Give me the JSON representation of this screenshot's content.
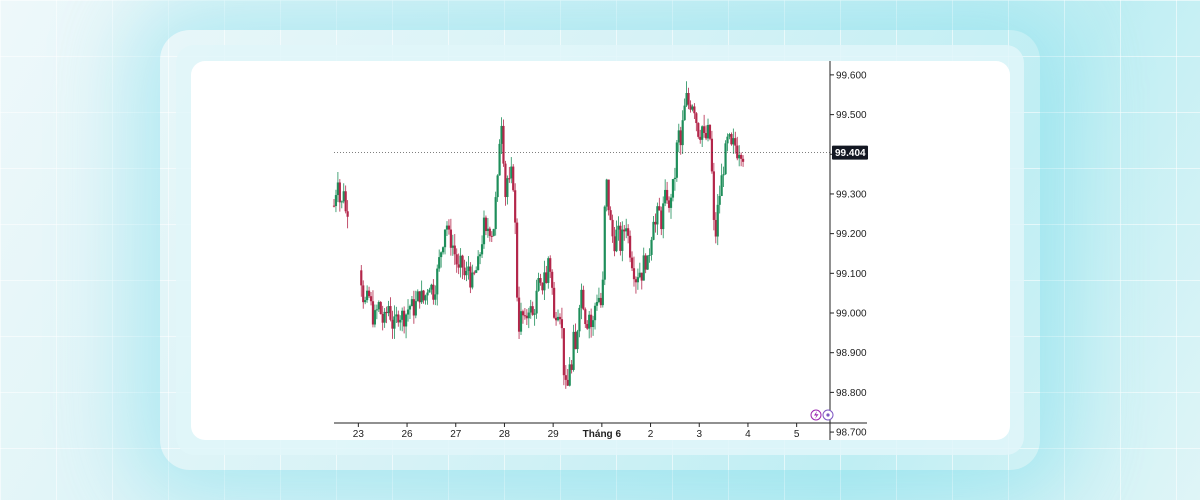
{
  "chart_data": {
    "type": "candlestick",
    "y_ticks": [
      "99.600",
      "99.500",
      "99.400",
      "99.300",
      "99.200",
      "99.100",
      "99.000",
      "98.900",
      "98.800",
      "98.700"
    ],
    "y_tick_values": [
      99.6,
      99.5,
      99.4,
      99.3,
      99.2,
      99.1,
      99.0,
      98.9,
      98.8,
      98.7
    ],
    "ylim": [
      98.68,
      99.635
    ],
    "last_price": 99.404,
    "last_price_label": "99.404",
    "x_tick_labels": [
      {
        "label": "23",
        "pos": 0.5,
        "bold": false
      },
      {
        "label": "26",
        "pos": 1.5,
        "bold": false
      },
      {
        "label": "27",
        "pos": 2.5,
        "bold": false
      },
      {
        "label": "28",
        "pos": 3.5,
        "bold": false
      },
      {
        "label": "29",
        "pos": 4.5,
        "bold": false
      },
      {
        "label": "Tháng 6",
        "pos": 5.5,
        "bold": true
      },
      {
        "label": "2",
        "pos": 6.5,
        "bold": false
      },
      {
        "label": "3",
        "pos": 7.5,
        "bold": false
      },
      {
        "label": "4",
        "pos": 8.5,
        "bold": false
      },
      {
        "label": "5",
        "pos": 9.5,
        "bold": false
      }
    ],
    "x_range": [
      0,
      10
    ],
    "price_path": [
      [
        0.0,
        99.27
      ],
      [
        0.08,
        99.35
      ],
      [
        0.14,
        99.25
      ],
      [
        0.2,
        99.32
      ],
      [
        0.26,
        99.22
      ],
      [
        0.3,
        99.31
      ],
      [
        0.55,
        99.1
      ],
      [
        0.62,
        99.02
      ],
      [
        0.72,
        99.04
      ],
      [
        0.82,
        98.98
      ],
      [
        0.92,
        99.02
      ],
      [
        1.02,
        98.97
      ],
      [
        1.12,
        99.02
      ],
      [
        1.22,
        98.96
      ],
      [
        1.32,
        99.0
      ],
      [
        1.45,
        98.99
      ],
      [
        1.55,
        99.02
      ],
      [
        1.65,
        99.01
      ],
      [
        1.75,
        99.05
      ],
      [
        1.85,
        99.03
      ],
      [
        1.95,
        99.08
      ],
      [
        2.05,
        99.05
      ],
      [
        2.12,
        99.1
      ],
      [
        2.2,
        99.16
      ],
      [
        2.26,
        99.2
      ],
      [
        2.3,
        99.24
      ],
      [
        2.36,
        99.19
      ],
      [
        2.42,
        99.18
      ],
      [
        2.5,
        99.14
      ],
      [
        2.56,
        99.1
      ],
      [
        2.62,
        99.13
      ],
      [
        2.7,
        99.08
      ],
      [
        2.76,
        99.12
      ],
      [
        2.82,
        99.07
      ],
      [
        2.9,
        99.1
      ],
      [
        2.96,
        99.12
      ],
      [
        3.02,
        99.17
      ],
      [
        3.08,
        99.22
      ],
      [
        3.12,
        99.19
      ],
      [
        3.18,
        99.23
      ],
      [
        3.22,
        99.2
      ],
      [
        3.28,
        99.22
      ],
      [
        3.32,
        99.28
      ],
      [
        3.38,
        99.35
      ],
      [
        3.42,
        99.53
      ],
      [
        3.46,
        99.45
      ],
      [
        3.52,
        99.3
      ],
      [
        3.56,
        99.34
      ],
      [
        3.6,
        99.32
      ],
      [
        3.66,
        99.36
      ],
      [
        3.7,
        99.3
      ],
      [
        3.76,
        99.05
      ],
      [
        3.8,
        98.97
      ],
      [
        3.86,
        99.0
      ],
      [
        3.92,
        98.97
      ],
      [
        4.0,
        99.02
      ],
      [
        4.08,
        98.99
      ],
      [
        4.14,
        99.03
      ],
      [
        4.2,
        99.07
      ],
      [
        4.26,
        99.05
      ],
      [
        4.32,
        99.11
      ],
      [
        4.36,
        99.07
      ],
      [
        4.4,
        99.14
      ],
      [
        4.46,
        99.1
      ],
      [
        4.52,
        98.98
      ],
      [
        4.58,
        99.02
      ],
      [
        4.66,
        99.0
      ],
      [
        4.72,
        98.86
      ],
      [
        4.78,
        98.78
      ],
      [
        4.84,
        98.88
      ],
      [
        4.88,
        98.85
      ],
      [
        4.92,
        98.93
      ],
      [
        4.96,
        98.9
      ],
      [
        5.02,
        99.0
      ],
      [
        5.06,
        99.07
      ],
      [
        5.12,
        99.03
      ],
      [
        5.18,
        98.97
      ],
      [
        5.24,
        99.0
      ],
      [
        5.3,
        98.95
      ],
      [
        5.36,
        99.02
      ],
      [
        5.42,
        99.05
      ],
      [
        5.48,
        99.02
      ],
      [
        5.52,
        99.07
      ],
      [
        5.58,
        99.35
      ],
      [
        5.64,
        99.27
      ],
      [
        5.7,
        99.2
      ],
      [
        5.76,
        99.18
      ],
      [
        5.82,
        99.21
      ],
      [
        5.88,
        99.17
      ],
      [
        5.94,
        99.2
      ],
      [
        6.0,
        99.23
      ],
      [
        6.04,
        99.19
      ],
      [
        6.08,
        99.16
      ],
      [
        6.14,
        99.12
      ],
      [
        6.2,
        99.09
      ],
      [
        6.26,
        99.11
      ],
      [
        6.32,
        99.1
      ],
      [
        6.38,
        99.14
      ],
      [
        6.44,
        99.12
      ],
      [
        6.5,
        99.18
      ],
      [
        6.56,
        99.25
      ],
      [
        6.6,
        99.22
      ],
      [
        6.66,
        99.26
      ],
      [
        6.72,
        99.23
      ],
      [
        6.78,
        99.28
      ],
      [
        6.84,
        99.3
      ],
      [
        6.88,
        99.25
      ],
      [
        6.94,
        99.33
      ],
      [
        6.98,
        99.3
      ],
      [
        7.02,
        99.4
      ],
      [
        7.08,
        99.45
      ],
      [
        7.12,
        99.42
      ],
      [
        7.18,
        99.5
      ],
      [
        7.24,
        99.54
      ],
      [
        7.3,
        99.52
      ],
      [
        7.34,
        99.54
      ],
      [
        7.4,
        99.52
      ],
      [
        7.46,
        99.47
      ],
      [
        7.5,
        99.45
      ],
      [
        7.56,
        99.47
      ],
      [
        7.62,
        99.42
      ],
      [
        7.66,
        99.46
      ],
      [
        7.72,
        99.44
      ],
      [
        7.76,
        99.35
      ],
      [
        7.8,
        99.22
      ],
      [
        7.84,
        99.2
      ],
      [
        7.88,
        99.26
      ],
      [
        7.94,
        99.32
      ],
      [
        8.0,
        99.37
      ],
      [
        8.06,
        99.42
      ],
      [
        8.1,
        99.44
      ],
      [
        8.16,
        99.41
      ],
      [
        8.22,
        99.43
      ],
      [
        8.28,
        99.41
      ],
      [
        8.34,
        99.42
      ],
      [
        8.4,
        99.4
      ]
    ]
  }
}
